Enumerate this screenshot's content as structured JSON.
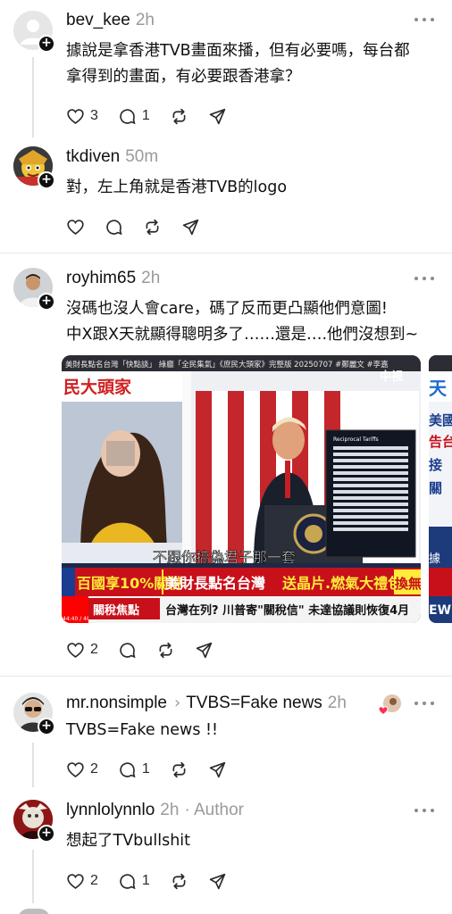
{
  "posts": [
    {
      "username": "bev_kee",
      "time": "2h",
      "text_lines": [
        "據說是拿香港TVB畫面來播，但有必要嗎，每台都",
        "拿得到的畫面，有必要跟香港拿？"
      ],
      "likes": "3",
      "replies": "1"
    },
    {
      "username": "tkdiven",
      "time": "50m",
      "text_lines": [
        "對，左上角就是香港TVB的logo"
      ]
    },
    {
      "username": "royhim65",
      "time": "2h",
      "text_lines": [
        "沒碼也沒人會care，碼了反而更凸顯他們意圖!",
        "中X跟X天就顯得聰明多了……還是….他們沒想到~"
      ],
      "likes": "2",
      "media": {
        "top_ticker": "美財長點名台灣「快點談」 綠廳「全民集氣」《庶民大頭家》完整版 20250707 #鄭麗文 #李嘉",
        "show_logo": "民大頭家",
        "channel_logo": "中視",
        "chart_title": "Reciprocal Tariffs",
        "subtitle": "不跟你搞偽君子那一套",
        "headline_1": "百國享10%關稅",
        "headline_2": "美財長點名台灣",
        "headline_3": "送晶片.燃氣大禮包",
        "headline_4": "換無安",
        "ticker_label": "關稅焦點",
        "ticker_text": "台灣在列? 川普寄\"關稅信\" 未達協議則恢復4月",
        "time_code": "44:40 / 48:50",
        "peek_text_1": "天",
        "peek_text_2": "美國",
        "peek_text_3": "告台",
        "peek_text_4": "接",
        "peek_text_5": "關",
        "peek_text_6": "據",
        "peek_text_7": "EW"
      }
    },
    {
      "username": "mr.nonsimple",
      "reply_to": "TVBS=Fake news",
      "time": "2h",
      "text_lines": [
        "TVBS=Fake news !!"
      ],
      "likes": "2",
      "replies": "1"
    },
    {
      "username": "lynnlolynnlo",
      "time": "2h",
      "author_tag": "· Author",
      "text_lines": [
        "想起了TVbullshit"
      ],
      "likes": "2",
      "replies": "1"
    }
  ],
  "icons": [
    "heart-icon",
    "comment-icon",
    "repost-icon",
    "share-icon",
    "more-icon",
    "follow-plus-icon"
  ],
  "colors": {
    "text": "#101010",
    "muted": "#9a9a9a",
    "divider": "#e8e8e8",
    "icon": "#2a2a2a"
  }
}
